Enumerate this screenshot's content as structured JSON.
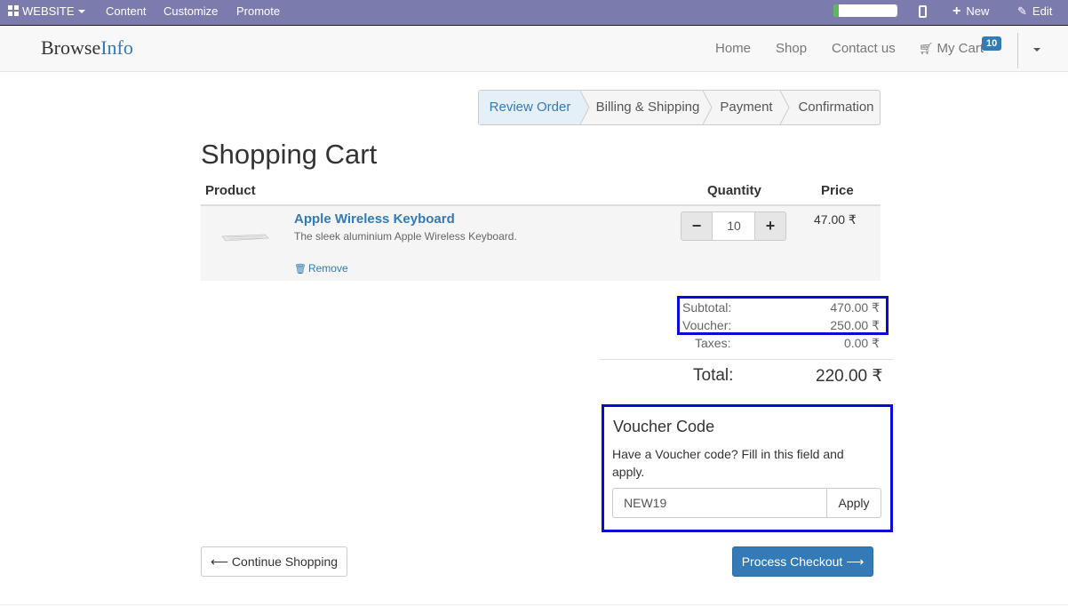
{
  "adminbar": {
    "website_label": "WEBSITE",
    "menu": [
      "Content",
      "Customize",
      "Promote"
    ],
    "progress_fraction": 0.08,
    "progress_color": "#5cb85c",
    "new_label": "New",
    "edit_label": "Edit",
    "bar_color": "#7c7bad"
  },
  "navbar": {
    "brand_part1": "Browse",
    "brand_part2": "Info",
    "links": [
      "Home",
      "Shop",
      "Contact us"
    ],
    "cart_label": "My Cart",
    "cart_count": "10"
  },
  "wizard": {
    "steps": [
      "Review Order",
      "Billing & Shipping",
      "Payment",
      "Confirmation"
    ],
    "active_index": 0
  },
  "cart": {
    "title": "Shopping Cart",
    "headers": {
      "product": "Product",
      "quantity": "Quantity",
      "price": "Price"
    },
    "items": [
      {
        "name": "Apple Wireless Keyboard",
        "description": "The sleek aluminium Apple Wireless Keyboard.",
        "remove_label": "Remove",
        "quantity": "10",
        "price": "47.00 ₹"
      }
    ]
  },
  "summary": {
    "subtotal_label": "Subtotal:",
    "subtotal_value": "470.00 ₹",
    "voucher_label": "Voucher:",
    "voucher_value": "250.00 ₹",
    "taxes_label": "Taxes:",
    "taxes_value": "0.00 ₹",
    "total_label": "Total:",
    "total_value": "220.00 ₹"
  },
  "voucher": {
    "title": "Voucher Code",
    "text": "Have a Voucher code? Fill in this field and apply.",
    "code_value": "NEW19",
    "apply_label": "Apply"
  },
  "actions": {
    "continue_label": "Continue Shopping",
    "checkout_label": "Process Checkout"
  },
  "colors": {
    "accent": "#337ab7",
    "highlight_box": "#0a0ad6"
  }
}
